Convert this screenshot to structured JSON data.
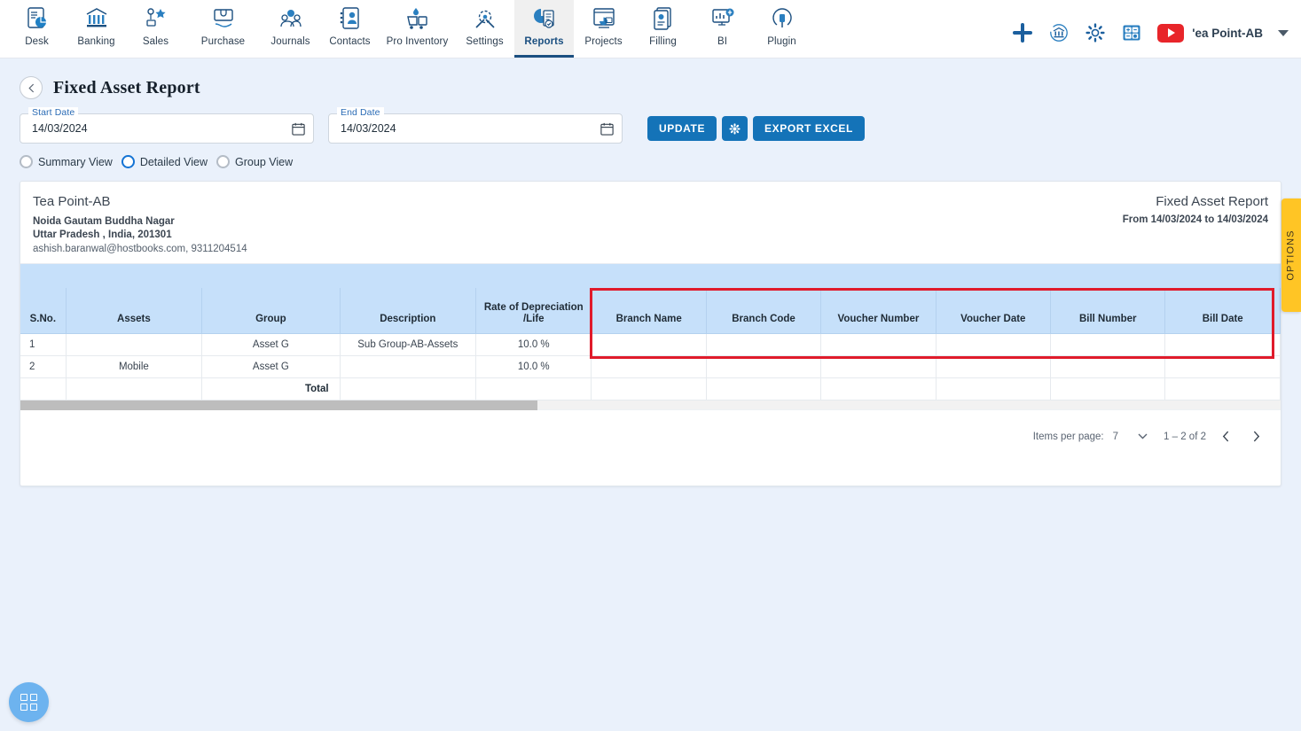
{
  "nav": {
    "items": [
      {
        "label": "Desk",
        "icon": "desk-icon"
      },
      {
        "label": "Banking",
        "icon": "bank-icon"
      },
      {
        "label": "Sales",
        "icon": "sales-icon"
      },
      {
        "label": "Purchase",
        "icon": "purchase-icon"
      },
      {
        "label": "Journals",
        "icon": "journals-icon"
      },
      {
        "label": "Contacts",
        "icon": "contacts-icon"
      },
      {
        "label": "Pro Inventory",
        "icon": "inventory-icon"
      },
      {
        "label": "Settings",
        "icon": "settings-icon"
      },
      {
        "label": "Reports",
        "icon": "reports-icon"
      },
      {
        "label": "Projects",
        "icon": "projects-icon"
      },
      {
        "label": "Filling",
        "icon": "filling-icon"
      },
      {
        "label": "BI",
        "icon": "bi-icon"
      },
      {
        "label": "Plugin",
        "icon": "plugin-icon"
      }
    ],
    "active": "Reports"
  },
  "topbar_right": {
    "add_icon": "plus-icon",
    "bank_sync_icon": "bank-refresh-icon",
    "settings_icon": "gear-icon",
    "calculator_icon": "calculator-icon",
    "youtube_icon": "youtube-icon",
    "company": "'ea Point-AB",
    "chevron": "chevron-down-icon"
  },
  "page": {
    "back_icon": "chevron-left-icon",
    "title": "Fixed Asset Report"
  },
  "filters": {
    "start_date": {
      "label": "Start Date",
      "value": "14/03/2024",
      "placeholder": "dd/mm/yyyy"
    },
    "end_date": {
      "label": "End Date",
      "value": "14/03/2024",
      "placeholder": "dd/mm/yyyy"
    },
    "update_label": "UPDATE",
    "settings_label": "gear-icon",
    "export_label": "EXPORT EXCEL"
  },
  "view_modes": [
    {
      "label": "Summary View",
      "selected": false
    },
    {
      "label": "Detailed View",
      "selected": true
    },
    {
      "label": "Group View",
      "selected": false
    }
  ],
  "report_header": {
    "company": "Tea Point-AB",
    "address_line1": "Noida Gautam Buddha Nagar",
    "address_line2": "Uttar Pradesh , India, 201301",
    "contact": "ashish.baranwal@hostbooks.com, 9311204514",
    "title": "Fixed Asset Report",
    "range": "From 14/03/2024 to 14/03/2024"
  },
  "table": {
    "columns": [
      "S.No.",
      "Assets",
      "Group",
      "Description",
      "Rate of Depreciation /Life",
      "Branch Name",
      "Branch Code",
      "Voucher Number",
      "Voucher Date",
      "Bill Number",
      "Bill Date"
    ],
    "rows": [
      {
        "sno": "1",
        "assets": "",
        "group": "Asset G",
        "description": "Sub Group-AB-Assets",
        "rate": "10.0 %",
        "branch_name": "",
        "branch_code": "",
        "voucher_number": "",
        "voucher_date": "",
        "bill_number": "",
        "bill_date": ""
      },
      {
        "sno": "2",
        "assets": "Mobile",
        "group": "Asset G",
        "description": "",
        "rate": "10.0 %",
        "branch_name": "",
        "branch_code": "",
        "voucher_number": "",
        "voucher_date": "",
        "bill_number": "",
        "bill_date": ""
      }
    ],
    "total_label": "Total",
    "highlight_color": "#e01b2b"
  },
  "paginator": {
    "items_per_page_label": "Items per page:",
    "items_per_page_value": "7",
    "range_label": "1 – 2 of 2",
    "prev_icon": "chevron-left-icon",
    "next_icon": "chevron-right-icon"
  },
  "options_tab": {
    "label": "OPTIONS",
    "color": "#ffc525"
  },
  "fab": {
    "icon": "apps-grid-icon",
    "color": "#6db3ef"
  }
}
